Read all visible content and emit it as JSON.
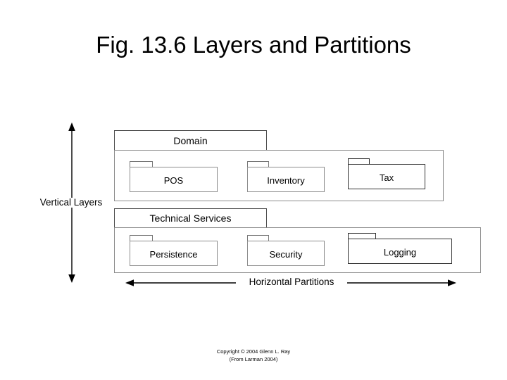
{
  "slide": {
    "title": "Fig. 13.6 Layers and Partitions",
    "footer": {
      "line1": "Copyright © 2004 Glenn L. Ray",
      "line2": "(From Larman 2004)"
    }
  },
  "diagram": {
    "axes": {
      "vertical": {
        "label": "Vertical Layers",
        "icon": "double-headed-vertical-arrow"
      },
      "horizontal": {
        "label": "Horizontal Partitions",
        "icon": "double-headed-horizontal-arrow"
      }
    },
    "layers": [
      {
        "name": "Domain",
        "packages": [
          {
            "name": "POS"
          },
          {
            "name": "Inventory"
          },
          {
            "name": "Tax"
          }
        ]
      },
      {
        "name": "Technical Services",
        "packages": [
          {
            "name": "Persistence"
          },
          {
            "name": "Security"
          },
          {
            "name": "Logging"
          }
        ]
      }
    ]
  },
  "colors": {
    "background": "#ffffff",
    "text": "#000000",
    "package_border": "#8a8a8a",
    "package_border_dark": "#333333",
    "arrow": "#000000"
  }
}
